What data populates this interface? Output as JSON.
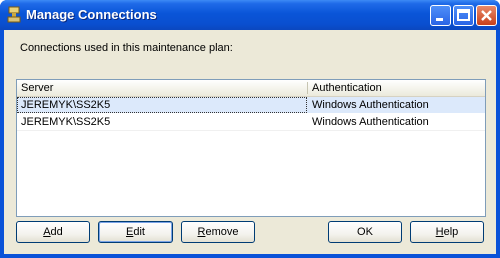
{
  "window": {
    "title": "Manage Connections"
  },
  "caption": "Connections used in this maintenance plan:",
  "table": {
    "columns": [
      "Server",
      "Authentication"
    ],
    "rows": [
      {
        "server": "JEREMYK\\SS2K5",
        "auth": "Windows Authentication",
        "selected": true
      },
      {
        "server": "JEREMYK\\SS2K5",
        "auth": "Windows Authentication",
        "selected": false
      }
    ]
  },
  "buttons": {
    "add": {
      "mnemonic": "A",
      "rest": "dd"
    },
    "edit": {
      "mnemonic": "E",
      "rest": "dit"
    },
    "remove": {
      "mnemonic": "R",
      "rest": "emove"
    },
    "ok": "OK",
    "help": {
      "mnemonic": "H",
      "rest": "elp"
    }
  },
  "colors": {
    "titlebar": "#0a52d8",
    "selection": "#dce9fb",
    "face": "#ece9d8"
  }
}
